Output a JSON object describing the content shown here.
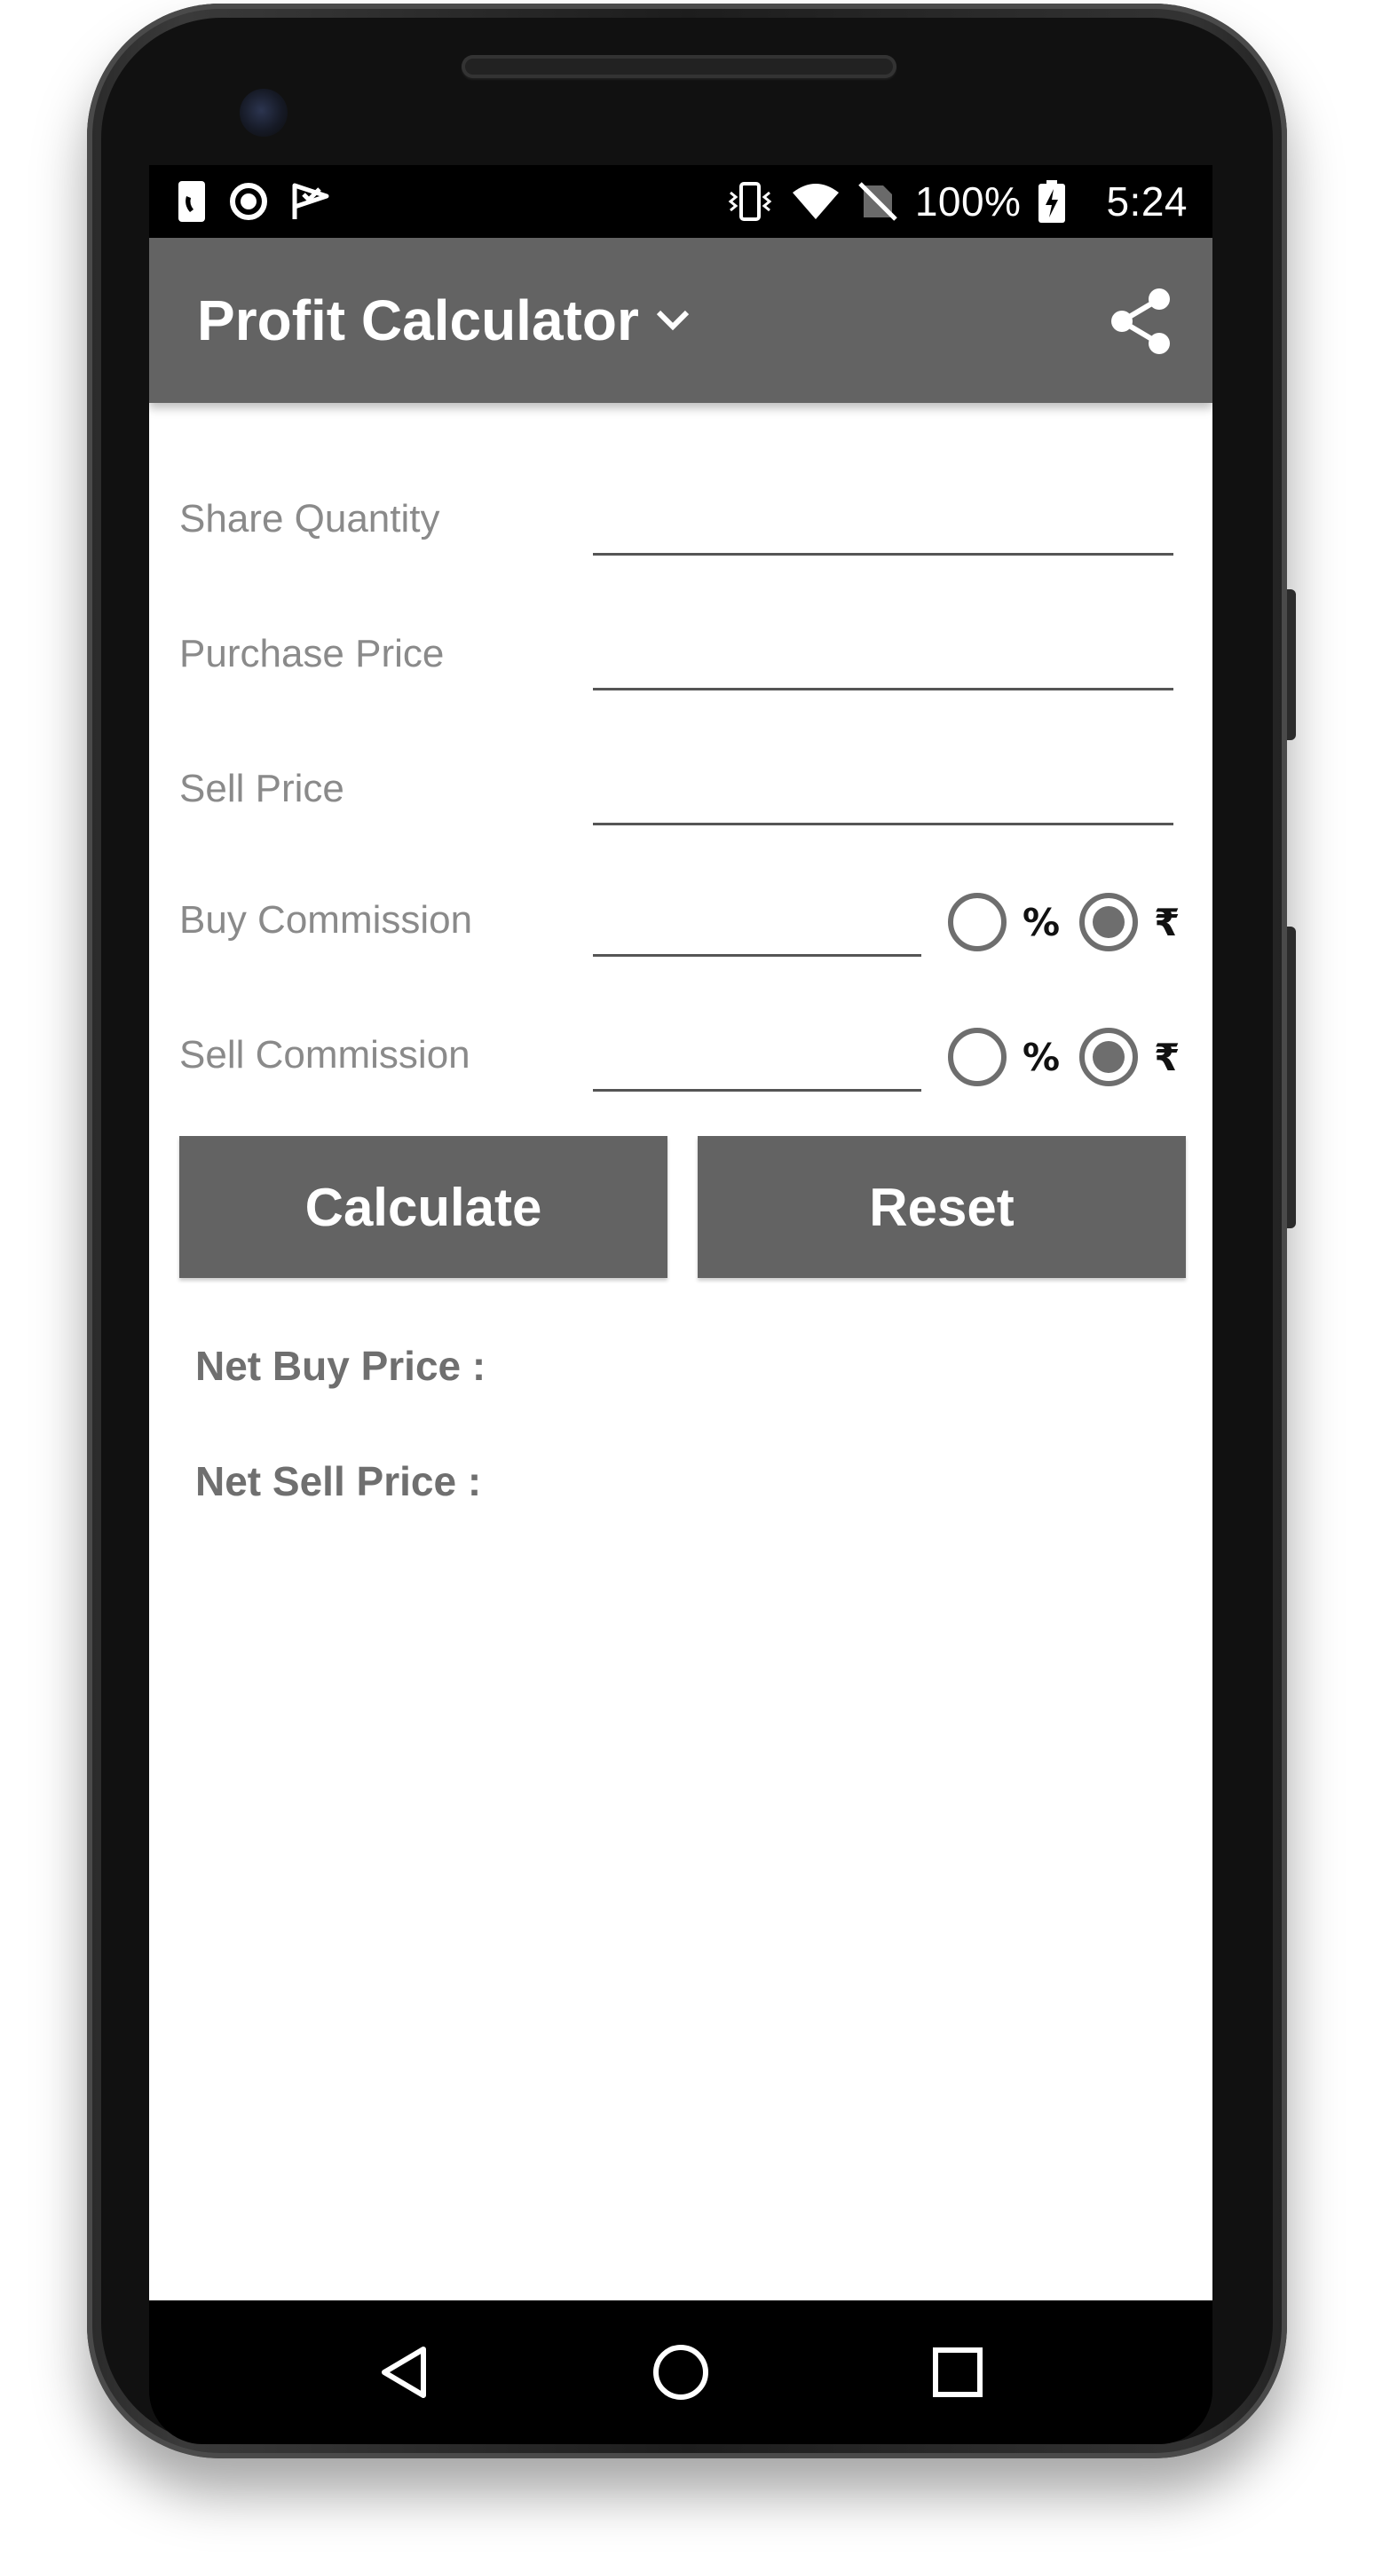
{
  "status_bar": {
    "battery": "100%",
    "time": "5:24"
  },
  "app_bar": {
    "title": "Profit Calculator"
  },
  "form": {
    "share_quantity": {
      "label": "Share Quantity",
      "value": ""
    },
    "purchase_price": {
      "label": "Purchase Price",
      "value": ""
    },
    "sell_price": {
      "label": "Sell Price",
      "value": ""
    },
    "buy_commission": {
      "label": "Buy Commission",
      "value": "",
      "percent_label": "%",
      "rupee_label": "₹",
      "selected": "rupee"
    },
    "sell_commission": {
      "label": "Sell Commission",
      "value": "",
      "percent_label": "%",
      "rupee_label": "₹",
      "selected": "rupee"
    }
  },
  "buttons": {
    "calculate": "Calculate",
    "reset": "Reset"
  },
  "results": {
    "net_buy_price": "Net Buy Price :",
    "net_sell_price": "Net Sell Price :"
  },
  "colors": {
    "app_bar": "#636363",
    "button": "#636363",
    "label": "#8a8a8a",
    "result_text": "#6f6f6f"
  },
  "icons": {
    "status_left": [
      "phone-notification-icon",
      "circle-notification-icon",
      "check-flag-icon"
    ],
    "status_right": [
      "vibrate-icon",
      "wifi-icon",
      "no-sim-icon",
      "battery-charging-icon"
    ],
    "app_bar": [
      "chevron-down-icon",
      "share-icon"
    ],
    "nav": [
      "back-icon",
      "home-icon",
      "recents-icon"
    ]
  }
}
